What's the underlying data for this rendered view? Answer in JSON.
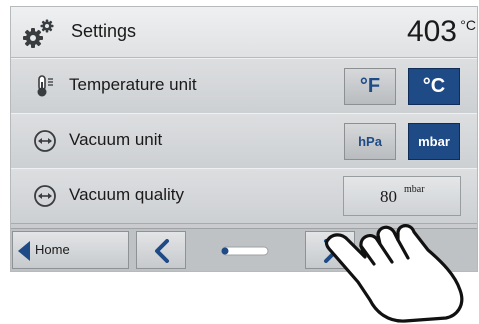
{
  "header": {
    "title": "Settings",
    "temperature": "403",
    "temperature_unit": "°C"
  },
  "rows": [
    {
      "label": "Temperature unit",
      "icon": "thermometer-icon",
      "options": [
        {
          "label": "°F",
          "selected": false
        },
        {
          "label": "°C",
          "selected": true
        }
      ]
    },
    {
      "label": "Vacuum unit",
      "icon": "vacuum-icon",
      "options": [
        {
          "label": "hPa",
          "selected": false
        },
        {
          "label": "mbar",
          "selected": true
        }
      ]
    },
    {
      "label": "Vacuum quality",
      "icon": "vacuum-icon",
      "value": "80",
      "value_unit": "mbar"
    }
  ],
  "nav": {
    "home_label": "Home",
    "page": 1,
    "page_count": 2
  },
  "colors": {
    "accent": "#1e4a86",
    "background": "#c9cbce"
  }
}
